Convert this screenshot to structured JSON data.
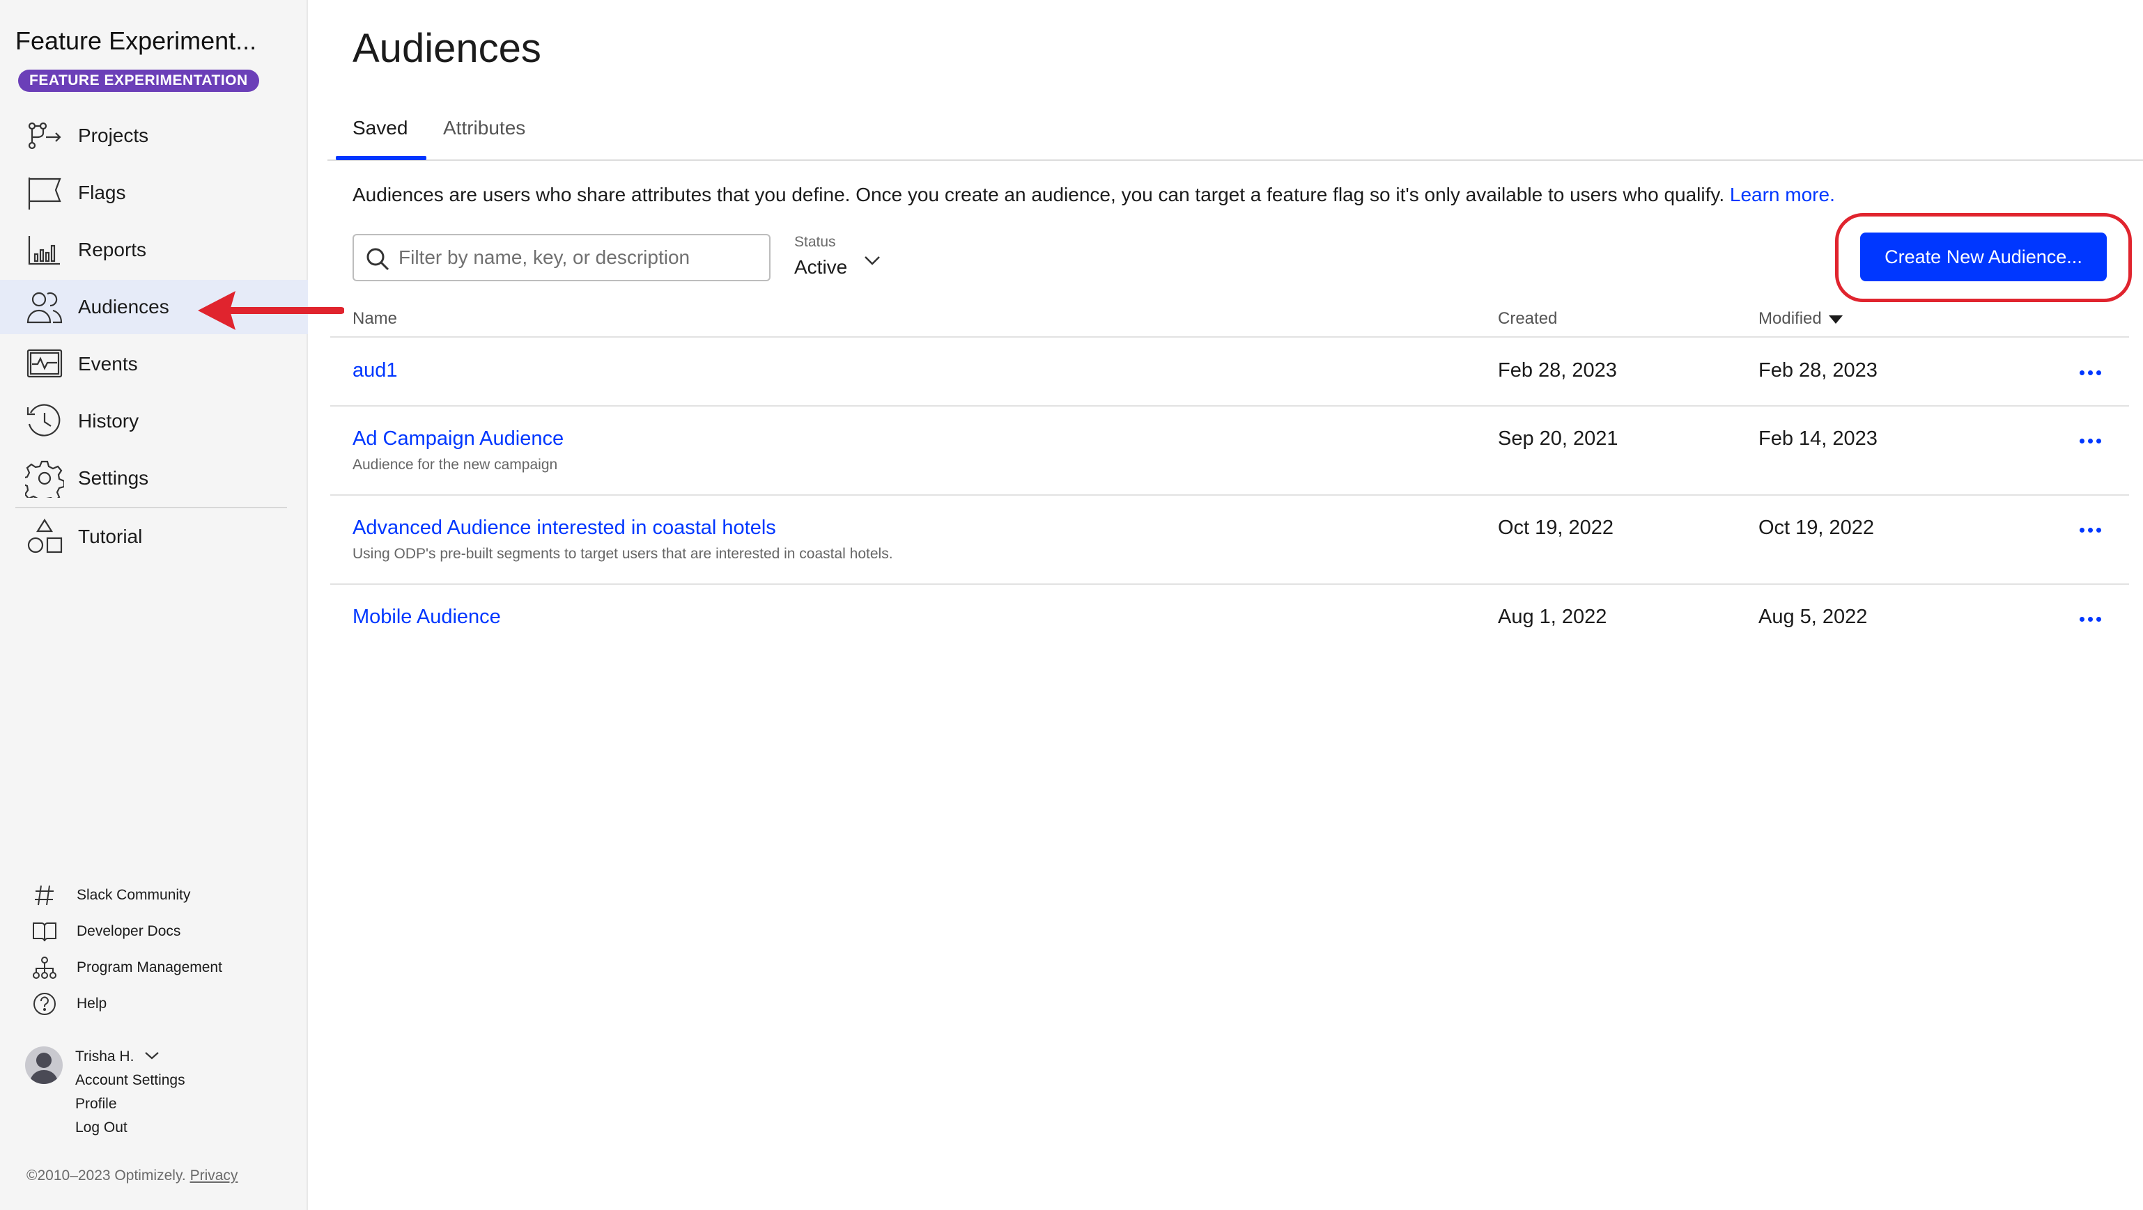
{
  "app": {
    "title": "Feature Experiment...",
    "badge": "FEATURE EXPERIMENTATION"
  },
  "sidebar": {
    "nav": [
      {
        "label": "Projects",
        "icon": "projects-icon"
      },
      {
        "label": "Flags",
        "icon": "flag-icon"
      },
      {
        "label": "Reports",
        "icon": "reports-icon"
      },
      {
        "label": "Audiences",
        "icon": "audiences-icon",
        "active": true
      },
      {
        "label": "Events",
        "icon": "events-icon"
      },
      {
        "label": "History",
        "icon": "history-icon"
      },
      {
        "label": "Settings",
        "icon": "gear-icon"
      },
      {
        "label": "Tutorial",
        "icon": "tutorial-icon"
      }
    ],
    "footer_links": [
      {
        "label": "Slack Community",
        "icon": "hash-icon"
      },
      {
        "label": "Developer Docs",
        "icon": "book-icon"
      },
      {
        "label": "Program Management",
        "icon": "org-chart-icon"
      },
      {
        "label": "Help",
        "icon": "help-icon"
      }
    ],
    "user": {
      "name": "Trisha H.",
      "menu": [
        "Account Settings",
        "Profile",
        "Log Out"
      ]
    },
    "copyright": "©2010–2023 Optimizely.",
    "privacy_label": "Privacy"
  },
  "main": {
    "title": "Audiences",
    "tabs": [
      {
        "label": "Saved",
        "active": true
      },
      {
        "label": "Attributes"
      }
    ],
    "intro_text": "Audiences are users who share attributes that you define. Once you create an audience, you can target a feature flag so it's only available to users who qualify.",
    "learn_more": "Learn more.",
    "search": {
      "placeholder": "Filter by name, key, or description",
      "value": ""
    },
    "status_filter": {
      "label": "Status",
      "value": "Active"
    },
    "create_button": "Create New Audience...",
    "table": {
      "columns": [
        "Name",
        "Created",
        "Modified"
      ],
      "sorted_by": "Modified",
      "rows": [
        {
          "name": "aud1",
          "description": "",
          "created": "Feb 28, 2023",
          "modified": "Feb 28, 2023"
        },
        {
          "name": "Ad Campaign Audience",
          "description": "Audience for the new campaign",
          "created": "Sep 20, 2021",
          "modified": "Feb 14, 2023"
        },
        {
          "name": "Advanced Audience interested in coastal hotels",
          "description": "Using ODP's pre-built segments to target users that are interested in coastal hotels.",
          "created": "Oct 19, 2022",
          "modified": "Oct 19, 2022"
        },
        {
          "name": "Mobile Audience",
          "description": "",
          "created": "Aug 1, 2022",
          "modified": "Aug 5, 2022"
        }
      ]
    }
  },
  "colors": {
    "accent": "#0037ff",
    "badge": "#6b3fb8",
    "annotation": "#e0242e",
    "active_nav_bg": "#e6ebf8"
  }
}
